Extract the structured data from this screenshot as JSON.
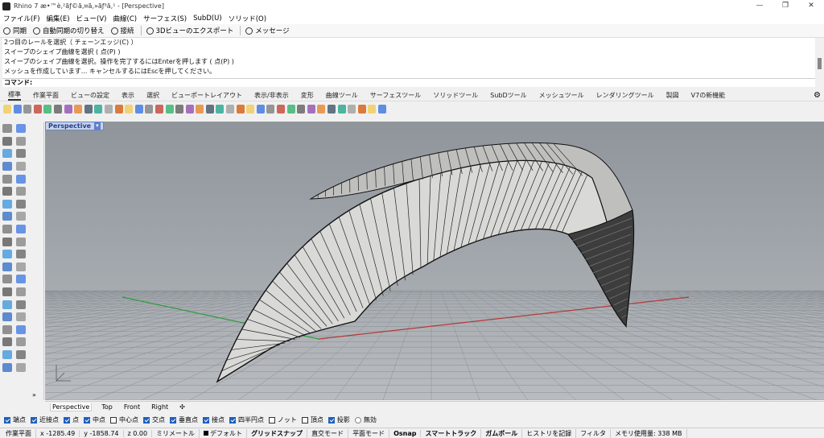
{
  "window": {
    "title": "Rhino 7 æ•™è‚²ãƒ©ã‚¤ã‚»ãƒ³ã‚¹ - [Perspective]",
    "controls": [
      "—",
      "❐",
      "✕"
    ]
  },
  "menu": [
    "ファイル(F)",
    "編集(E)",
    "ビュー(V)",
    "曲線(C)",
    "サーフェス(S)",
    "SubD(U)",
    "ソリッド(O)"
  ],
  "cmdbar": {
    "sync": "同期",
    "auto_sync": "自動同期の切り替え",
    "connect": "接続",
    "export3d": "3Dビューのエクスポート",
    "message": "メッセージ"
  },
  "history": [
    "2つ目のレールを選択（ チェーンエッジ(C) ）",
    "スイープのシェイプ曲線を選択 ( 点(P) )",
    "スイープのシェイプ曲線を選択。操作を完了するにはEnterを押します ( 点(P) )",
    "メッシュを作成しています... キャンセルするにはEscを押してください。"
  ],
  "command": {
    "label": "コマンド:",
    "value": ""
  },
  "tabs": [
    "標準",
    "作業平面",
    "ビューの設定",
    "表示",
    "選択",
    "ビューポートレイアウト",
    "表示/非表示",
    "変形",
    "曲線ツール",
    "サーフェスツール",
    "ソリッドツール",
    "SubDツール",
    "メッシュツール",
    "レンダリングツール",
    "製図",
    "V7の新機能"
  ],
  "viewport": {
    "title": "Perspective",
    "menu_icon": "▾"
  },
  "viewport_tabs": [
    "Perspective",
    "Top",
    "Front",
    "Right",
    "✣"
  ],
  "osnaps": [
    {
      "label": "端点",
      "on": true
    },
    {
      "label": "近接点",
      "on": true
    },
    {
      "label": "点",
      "on": true
    },
    {
      "label": "中点",
      "on": true
    },
    {
      "label": "中心点",
      "on": false
    },
    {
      "label": "交点",
      "on": true
    },
    {
      "label": "垂直点",
      "on": true
    },
    {
      "label": "接点",
      "on": true
    },
    {
      "label": "四半円点",
      "on": true
    },
    {
      "label": "ノット",
      "on": false
    },
    {
      "label": "頂点",
      "on": false
    },
    {
      "label": "投影",
      "on": true
    }
  ],
  "disable_label": "無効",
  "status": {
    "cplane": "作業平面",
    "x": "x -1285.49",
    "y": "y -1858.74",
    "z": "z 0.00",
    "units": "ミリメートル",
    "layer": "デフォルト",
    "grid_snap": "グリッドスナップ",
    "ortho": "直交モード",
    "planar": "平面モード",
    "osnap": "Osnap",
    "smarttrack": "スマートトラック",
    "gumball": "ガムボール",
    "history": "ヒストリを記録",
    "filter": "フィルタ",
    "memory": "メモリ使用量: 338 MB"
  },
  "colors": {
    "x_axis": "#b33a3a",
    "y_axis": "#2e9c3e",
    "accent": "#1f5fbf"
  }
}
